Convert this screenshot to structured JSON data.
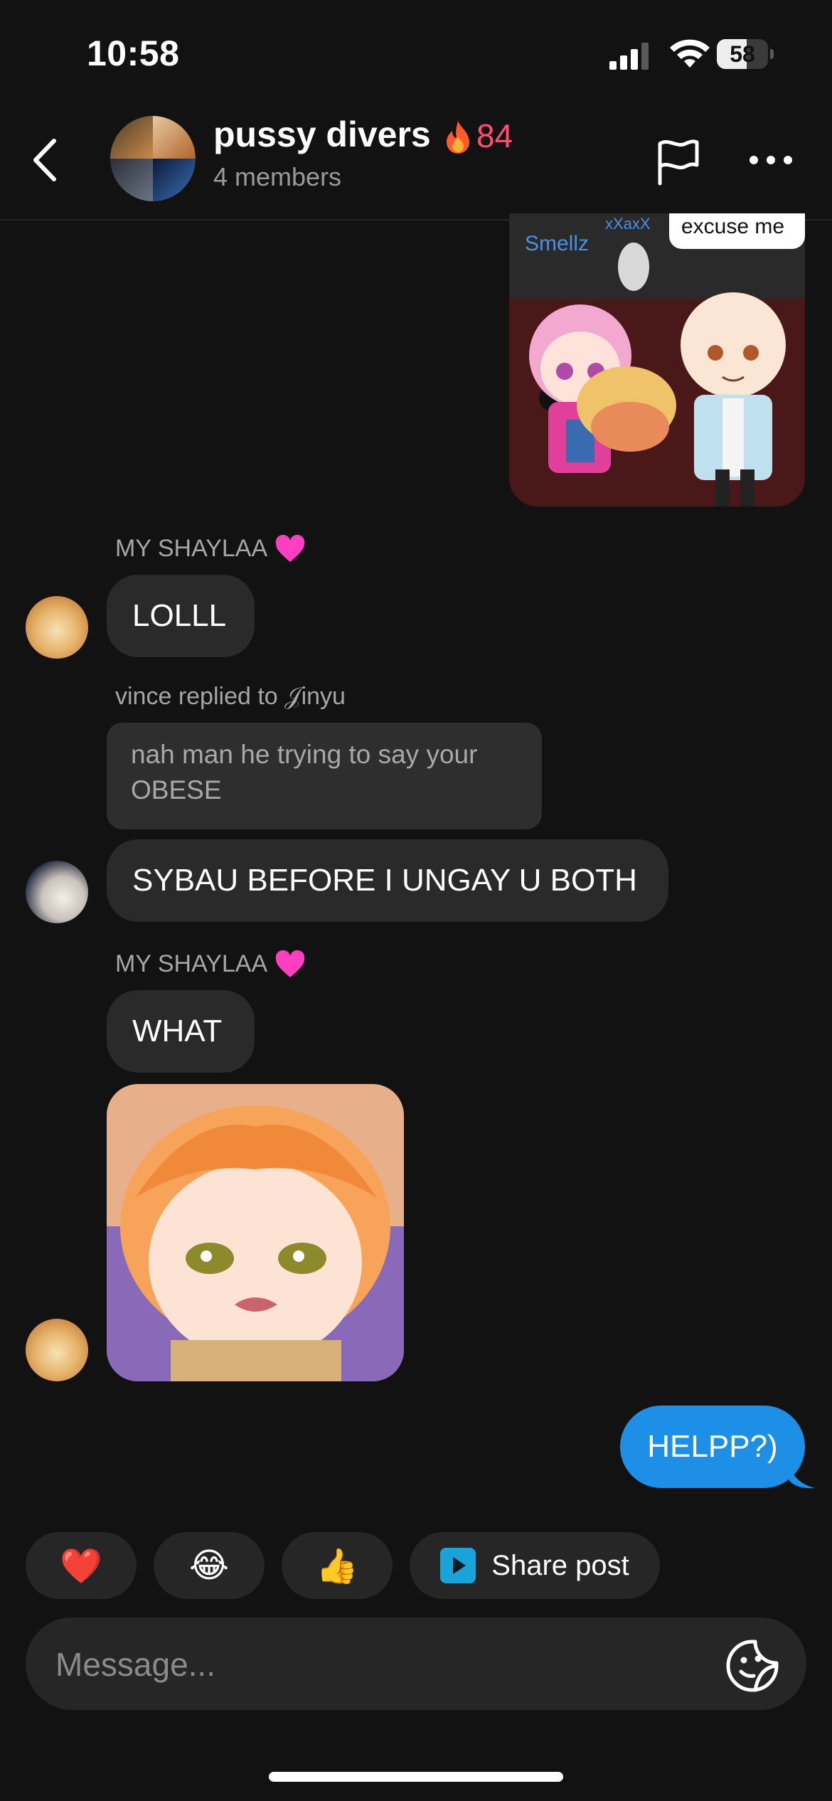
{
  "status_bar": {
    "time": "10:58",
    "battery_level": "58",
    "battery_fraction": 0.58
  },
  "header": {
    "group_name": "pussy divers",
    "streak_count": "84",
    "members_label": "4 members"
  },
  "messages": [
    {
      "type": "image",
      "direction": "outgoing",
      "overlay_texts": [
        "excuse me",
        "Smellz",
        "xXaxX"
      ]
    },
    {
      "type": "text",
      "direction": "incoming",
      "sender": "MY SHAYLAA",
      "sender_suffix_icon": "pink-heart",
      "text": "LOLLL"
    },
    {
      "type": "reply",
      "direction": "incoming",
      "reply_label": "vince replied to 𝒥inyu",
      "quoted_text": "nah man he trying to say your OBESE",
      "text": "SYBAU BEFORE I UNGAY U BOTH"
    },
    {
      "type": "text",
      "direction": "incoming",
      "sender": "MY SHAYLAA",
      "sender_suffix_icon": "pink-heart",
      "text": "WHAT"
    },
    {
      "type": "sticker",
      "direction": "incoming"
    },
    {
      "type": "text",
      "direction": "outgoing",
      "text": "HELPP?)"
    }
  ],
  "quick_reactions": {
    "heart": "❤️",
    "laugh": "😂",
    "thumbs_up": "👍",
    "share_label": "Share post"
  },
  "composer": {
    "placeholder": "Message..."
  },
  "colors": {
    "background": "#121212",
    "outgoing_bubble": "#1e8fe6",
    "incoming_bubble": "#2a2a2a",
    "streak": "#ff4f6e",
    "heart": "#ff3fbf"
  }
}
